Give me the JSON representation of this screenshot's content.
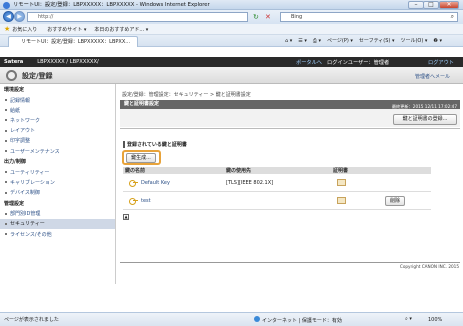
{
  "window": {
    "title": "リモートUI：設定/登録：LBPXXXXX：LBPXXXXX - Windows Internet Explorer"
  },
  "address": {
    "url": "http://",
    "search_placeholder": "Bing"
  },
  "favorites": {
    "label": "お気に入り",
    "links": [
      "おすすめサイト ▾",
      "本日のおすすめアド... ▾"
    ]
  },
  "tab": {
    "label": "リモートUI：設定/登録：LBPXXXXX：LBPXX..."
  },
  "ie_toolbar": {
    "items": [
      "ページ(P) ▾",
      "セーフティ(S) ▾",
      "ツール(O) ▾",
      "❷ ▾"
    ]
  },
  "app": {
    "brand": "Satera",
    "device": "LBPXXXXX / LBPXXXXX/",
    "portal_link": "ポータルへ",
    "login_user": "ログインユーザー：管理者",
    "logout": "ログアウト",
    "page_heading": "設定/登録",
    "admin_link": "管理者へメール"
  },
  "sidebar": {
    "sections": [
      {
        "title": "環境設定",
        "items": [
          "記録情報",
          "給紙",
          "ネットワーク",
          "レイアウト",
          "印字調整",
          "ユーザーメンテナンス"
        ]
      },
      {
        "title": "出力/制御",
        "items": [
          "ユーティリティー",
          "キャリブレーション",
          "デバイス制御"
        ]
      },
      {
        "title": "管理設定",
        "items": [
          "部門別ID管理",
          "セキュリティー",
          "ライセンス/その他"
        ]
      }
    ],
    "active": "セキュリティー"
  },
  "main": {
    "breadcrumb": "設定/登録：管理設定：セキュリティー > 鍵と証明書設定",
    "panel_title": "鍵と証明書設定",
    "last_update": "最終更新：2015 12/11 17:02:47",
    "key_cert_button": "鍵と証明書の登録...",
    "section_title": "登録されている鍵と証明書",
    "create_button": "鍵生成...",
    "table": {
      "headers": [
        "鍵の名前",
        "鍵の使用先",
        "証明書",
        ""
      ],
      "rows": [
        {
          "name": "Default Key",
          "usage": "[TLS][IEEE 802.1X]",
          "action": ""
        },
        {
          "name": "test",
          "usage": "",
          "action": "削除"
        }
      ]
    },
    "copyright": "Copyright CANON INC. 2015"
  },
  "status": {
    "left": "ページが表示されました",
    "zone": "インターネット | 保護モード：有効",
    "zoom": "100%"
  }
}
